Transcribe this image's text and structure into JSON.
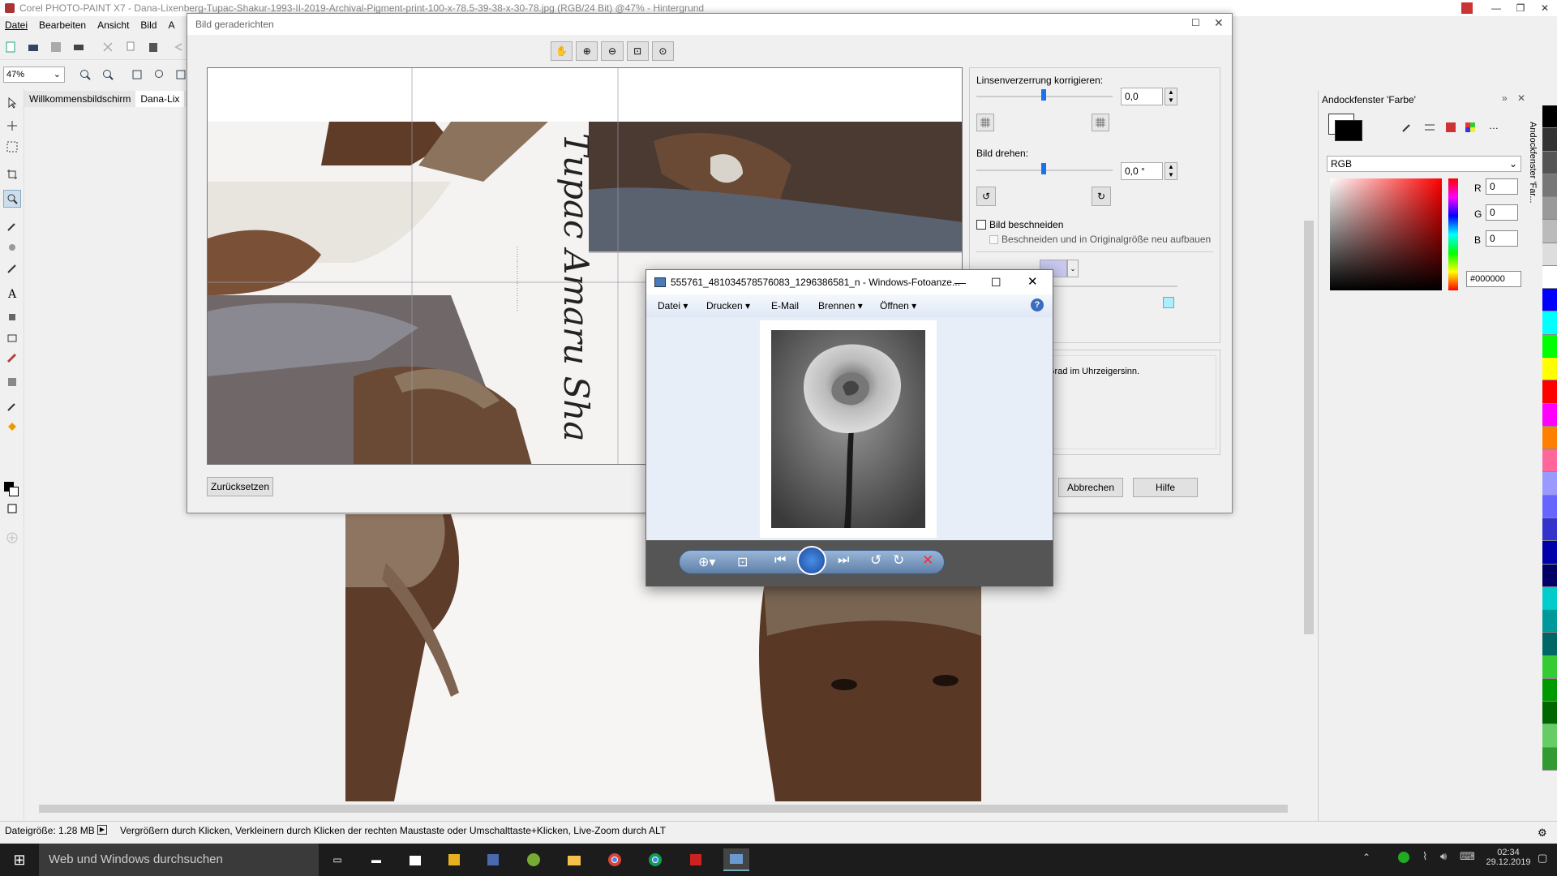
{
  "app": {
    "title": "Corel PHOTO-PAINT X7 - Dana-Lixenberg-Tupac-Shakur-1993-II-2019-Archival-Pigment-print-100-x-78.5-39-38-x-30-78.jpg (RGB/24 Bit) @47% - Hintergrund",
    "menu": [
      "Datei",
      "Bearbeiten",
      "Ansicht",
      "Bild",
      "A"
    ],
    "zoom": "47%",
    "tabs": [
      "Willkommensbildschirm",
      "Dana-Lix"
    ]
  },
  "dialog": {
    "title": "Bild geraderichten",
    "lens_label": "Linsenverzerrung korrigieren:",
    "lens_value": "0,0",
    "rotate_label": "Bild drehen:",
    "rotate_value": "0,0 °",
    "crop_label": "Bild beschneiden",
    "crop_resize_label": "Beschneiden und in Originalgröße neu aufbauen",
    "hint_text": "Grad im Uhrzeigersinn.",
    "reset_button": "Zurücksetzen",
    "cancel_button": "Abbrechen",
    "help_button": "Hilfe",
    "preview_script_text": "Tupac Amaru Sha"
  },
  "docker": {
    "title": "Andockfenster 'Farbe'",
    "side_tab": "Andockfenster 'Far...",
    "model": "RGB",
    "r": "0",
    "g": "0",
    "b": "0",
    "r_label": "R",
    "g_label": "G",
    "b_label": "B",
    "hex": "#000000"
  },
  "photo_viewer": {
    "title": "555761_481034578576083_1296386581_n - Windows-Fotoanze...",
    "menu": [
      "Datei",
      "Drucken",
      "E-Mail",
      "Brennen",
      "Öffnen"
    ]
  },
  "status": {
    "file_size": "Dateigröße: 1.28 MB",
    "hint": "Vergrößern durch Klicken, Verkleinern durch Klicken der rechten Maustaste oder Umschalttaste+Klicken, Live-Zoom durch ALT"
  },
  "taskbar": {
    "search_placeholder": "Web und Windows durchsuchen",
    "time": "02:34",
    "date": "29.12.2019"
  },
  "palette_colors": [
    "#000000",
    "#333333",
    "#555555",
    "#777777",
    "#999999",
    "#bbbbbb",
    "#dddddd",
    "#ffffff",
    "#0000ff",
    "#00ffff",
    "#00ff00",
    "#ffff00",
    "#ff0000",
    "#ff00ff",
    "#ff8000",
    "#ff6699",
    "#9999ff",
    "#6666ff",
    "#3333cc",
    "#0000aa",
    "#000066",
    "#00cccc",
    "#009999",
    "#006666",
    "#33cc33",
    "#009900",
    "#006600",
    "#66cc66",
    "#339933"
  ]
}
